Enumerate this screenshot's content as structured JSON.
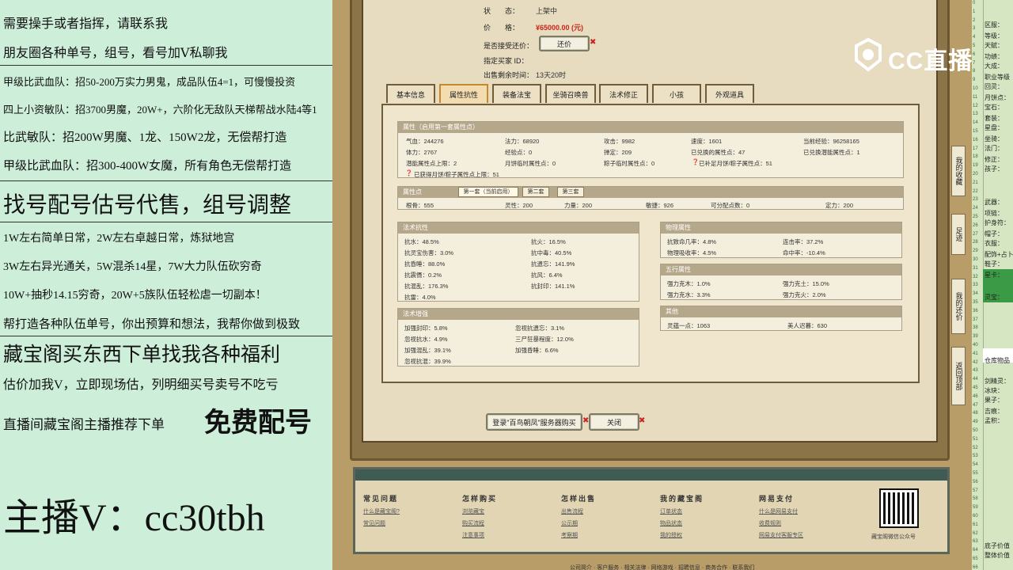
{
  "left_panel": {
    "lines": [
      "需要操手或者指挥，请联系我",
      "朋友圈各种单号，组号，看号加Ⅴ私聊我",
      "甲级比武血队：招50-200万实力男鬼，成品队伍4=1，可慢慢投资",
      "四上小资敏队：招3700男魔，20W+，六阶化无敌队天梯帮战水陆4等1",
      "比武敏队：招200W男魔、1龙、150W2龙，无偿帮打造",
      "甲级比武血队：招300-400W女魔，所有角色无偿帮打造",
      "找号配号估号代售，组号调整",
      "1W左右简单日常，2W左右卓越日常，炼狱地宫",
      "3W左右异光通关，5W混杀14星，7W大力队伍砍穷奇",
      "10W+抽秒14.15穷奇，20W+5族队伍轻松虐一切副本！",
      "帮打造各种队伍单号，你出预算和想法，我帮你做到极致",
      "藏宝阁买东西下单找我各种福利",
      "估价加我V，立即现场估，列明细买号卖号不吃亏",
      "直播间藏宝阁主播推荐下单",
      "免费配号",
      "主播V：cc30tbh"
    ]
  },
  "sale_info": {
    "status_label": "状　　态：",
    "status_value": "上架中",
    "price_label": "价　　格：",
    "price_value": "¥65000.00 (元)",
    "bargain_label": "是否接受还价：",
    "bargain_button": "还价",
    "buyer_id_label": "指定买家 ID：",
    "remaining_label": "出售剩余时间：",
    "remaining_value": "13天20时"
  },
  "tabs": [
    "基本信息",
    "属性抗性",
    "装备法宝",
    "坐骑召唤兽",
    "法术修正",
    "小孩",
    "外观道具"
  ],
  "active_tab": "属性抗性",
  "attributes": {
    "title": "属性（启用第一套属性点）",
    "cells": [
      "气血：244276",
      "法力：68920",
      "攻击：9982",
      "速度：1601",
      "当前经验：96258165",
      "体力：2767",
      "经验点：0",
      "掸定：209",
      "已兑换的属性点：47",
      "已兑换潜能属性点：1",
      "潜能属性点上限：2",
      "月饼临时属性点：0",
      "粽子临时属性点：0",
      "已补足月饼/粽子属性点：51",
      "已获得月饼/粽子属性点上限：51"
    ]
  },
  "points": {
    "title": "属性点",
    "tabs": [
      "第一套（当前启用）",
      "第二套",
      "第三套"
    ],
    "cells": [
      "根骨：555",
      "灵性：200",
      "力量：200",
      "敏捷：926",
      "可分配点数：0",
      "定力：200"
    ]
  },
  "resist": {
    "title": "法术抗性",
    "cells": [
      "抗水：48.5%",
      "抗火：16.5%",
      "抗灵宝伤害：3.0%",
      "抗中毒：40.5%",
      "抗昏睡：88.0%",
      "抗遗忘：141.9%",
      "抗震慑：0.2%",
      "抗风：6.4%",
      "抗混乱：176.3%",
      "抗封印：141.1%",
      "抗雷：4.0%"
    ]
  },
  "enhance": {
    "title": "法术增强",
    "cells": [
      "加强封印：5.8%",
      "忽视抗遗忘：3.1%",
      "忽视抗水：4.9%",
      "三尸狂暴程度：12.0%",
      "加强混乱：39.1%",
      "加强昏睡：6.6%",
      "忽视抗混：39.9%"
    ]
  },
  "physical": {
    "title": "物理属性",
    "cells": [
      "抗致命几率：4.8%",
      "连击率：37.2%",
      "物理吸收率：4.5%",
      "命中率：-10.4%"
    ]
  },
  "five": {
    "title": "五行属性",
    "cells": [
      "强力克木：1.0%",
      "强力克土：15.0%",
      "强力克水：3.3%",
      "强力克火：2.0%"
    ]
  },
  "other": {
    "title": "其他",
    "cells": [
      "灵蕴一点：1063",
      "美人迟暮：630"
    ]
  },
  "buttons": {
    "login": "登录\"百鸟朝凤\"服务器购买",
    "close": "关闭"
  },
  "footer": {
    "columns": [
      {
        "title": "常见问题",
        "items": [
          "什么是藏宝阁?",
          "常见问题"
        ]
      },
      {
        "title": "怎样购买",
        "items": [
          "浏览藏宝",
          "购买流程",
          "注意事项"
        ]
      },
      {
        "title": "怎样出售",
        "items": [
          "出售流程",
          "公示期",
          "考察期"
        ]
      },
      {
        "title": "我的藏宝阁",
        "items": [
          "订单状态",
          "物品状态",
          "我的授权"
        ]
      },
      {
        "title": "网易支付",
        "items": [
          "什么是网易支付",
          "收费规则",
          "网易支付客服专区"
        ]
      }
    ],
    "qr_caption": "藏宝阁微信公众号"
  },
  "bottom_links": "公司简介 · 客户服务 · 相关法律 · 网络游戏 · 招聘信息 · 商务合作 · 联系我们",
  "side_buttons": [
    "我的收藏",
    "足迹",
    "我的还价",
    "返回顶部"
  ],
  "logo_text": "CC直播",
  "right_panel": {
    "labels": [
      "区服：",
      "等级：",
      "天赋：",
      "功绩：",
      "大成：",
      "职业等级",
      "回灵：",
      "月饼点：",
      "宝石：",
      "套装：",
      "星盘：",
      "坐骑：",
      "法门：",
      "修正：",
      "孩子：",
      "武器：",
      "项链：",
      "护身符：",
      "帽子：",
      "衣服：",
      "配饰+占卜",
      "鞋子：",
      "星卡：",
      "灵宝：",
      "仓库物品",
      "剑精灵：",
      "冰玦：",
      "果子：",
      "吉痕：",
      "孟积：",
      "底子价值",
      "整体价值"
    ],
    "numbers": [
      "0",
      "1",
      "2",
      "3",
      "4",
      "5",
      "6",
      "7",
      "8",
      "9",
      "10",
      "11",
      "12",
      "13",
      "14",
      "15",
      "16",
      "17",
      "18",
      "19",
      "20",
      "21",
      "22",
      "23",
      "24",
      "25",
      "26",
      "27",
      "28",
      "29",
      "30",
      "31",
      "32",
      "33",
      "34",
      "35",
      "36",
      "37",
      "38",
      "39",
      "40",
      "41",
      "42",
      "43",
      "44",
      "45",
      "46",
      "47",
      "48",
      "49",
      "50",
      "51",
      "52",
      "53",
      "54",
      "55",
      "56",
      "57",
      "58",
      "59",
      "60",
      "61",
      "62",
      "63",
      "64",
      "65",
      "66"
    ]
  }
}
